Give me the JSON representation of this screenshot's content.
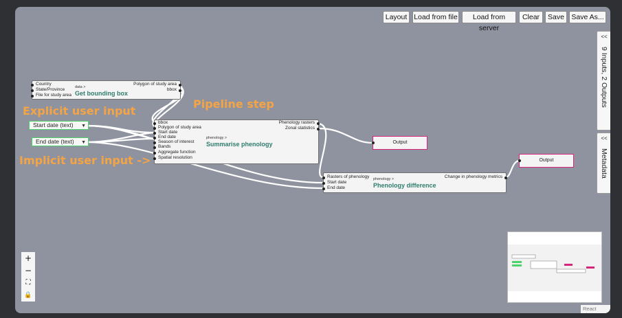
{
  "toolbar": {
    "layout": "Layout",
    "load_file": "Load from file",
    "load_server": "Load from server",
    "clear": "Clear",
    "save": "Save",
    "save_as": "Save As..."
  },
  "side_tabs": {
    "io": {
      "chevron": "<<",
      "label": "9 Inputs, 2 Outputs"
    },
    "metadata": {
      "chevron": "<<",
      "label": "Metadata"
    }
  },
  "annotations": {
    "explicit": "Explicit user input",
    "pipeline": "Pipeline step",
    "implicit": "Implicit user input ->"
  },
  "nodes": {
    "bbox": {
      "subtitle": "data >",
      "title": "Get bounding box",
      "inputs": [
        "Country",
        "State/Province",
        "File for study area"
      ],
      "outputs": [
        "Polygon of study area",
        "bbox"
      ]
    },
    "summarise": {
      "subtitle": "phenology >",
      "title": "Summarise phenology",
      "inputs": [
        "bbox",
        "Polygon of study area",
        "Start date",
        "End date",
        "Season of interest",
        "Bands",
        "Aggregate function",
        "Spatial resolution"
      ],
      "outputs": [
        "Phenology rasters",
        "Zonal statistics"
      ]
    },
    "difference": {
      "subtitle": "phenology >",
      "title": "Phenology difference",
      "inputs": [
        "Rasters of phenology",
        "Start date",
        "End date"
      ],
      "outputs": [
        "Change in phenology metrics"
      ]
    },
    "start_input": "Start date (text)",
    "end_input": "End date (text)",
    "output1": "Output",
    "output2": "Output"
  },
  "icons": {
    "caret": "▼",
    "zoom_in": "+",
    "zoom_out": "−",
    "fit_view": "⛶",
    "lock": "🔒"
  },
  "colors": {
    "canvas": "#8f939f",
    "input_border": "#4cd26a",
    "output_border": "#d6257a",
    "title_teal": "#2f7d6e",
    "annotation": "#f5a445"
  },
  "attribution": "React Flow"
}
